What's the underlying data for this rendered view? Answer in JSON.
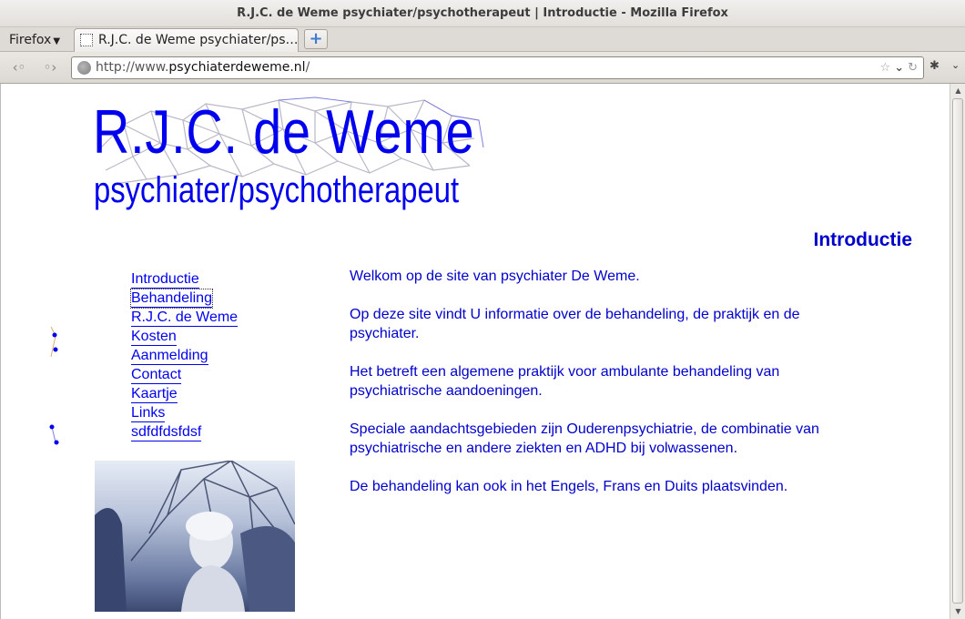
{
  "window": {
    "title": "R.J.C. de Weme psychiater/psychotherapeut | Introductie - Mozilla Firefox"
  },
  "browser": {
    "menu_label": "Firefox",
    "tab_title": "R.J.C. de Weme psychiater/ps…",
    "new_tab_label": "+",
    "url_prefix": "http://www.",
    "url_host": "psychiaterdeweme.nl",
    "url_suffix": "/"
  },
  "site": {
    "title": "R.J.C. de Weme",
    "subtitle": "psychiater/psychotherapeut",
    "section_heading": "Introductie"
  },
  "nav": {
    "items": [
      {
        "label": "Introductie"
      },
      {
        "label": "Behandeling"
      },
      {
        "label": "R.J.C. de Weme"
      },
      {
        "label": "Kosten"
      },
      {
        "label": "Aanmelding"
      },
      {
        "label": "Contact"
      },
      {
        "label": "Kaartje"
      },
      {
        "label": "Links"
      },
      {
        "label": "sdfdfdsfdsf"
      }
    ]
  },
  "content": {
    "paragraphs": [
      "Welkom op de site van  psychiater De Weme.",
      "Op deze site vindt U informatie over de behandeling, de praktijk en de psychiater.",
      "Het betreft een algemene praktijk voor ambulante behandeling van psychiatrische aandoeningen.",
      "Speciale aandachtsgebieden zijn Ouderenpsychiatrie, de combinatie van psychiatrische en andere ziekten en ADHD bij volwassenen.",
      "De behandeling kan ook in het Engels, Frans en Duits plaatsvinden."
    ]
  },
  "colors": {
    "link": "#0000ee",
    "text": "#0000cc"
  },
  "icons": {
    "back": "back-arrow-icon",
    "forward": "forward-arrow-icon",
    "site": "globe-icon",
    "bookmark": "star-icon",
    "dropdown": "chevron-down-icon",
    "reload": "reload-icon"
  }
}
